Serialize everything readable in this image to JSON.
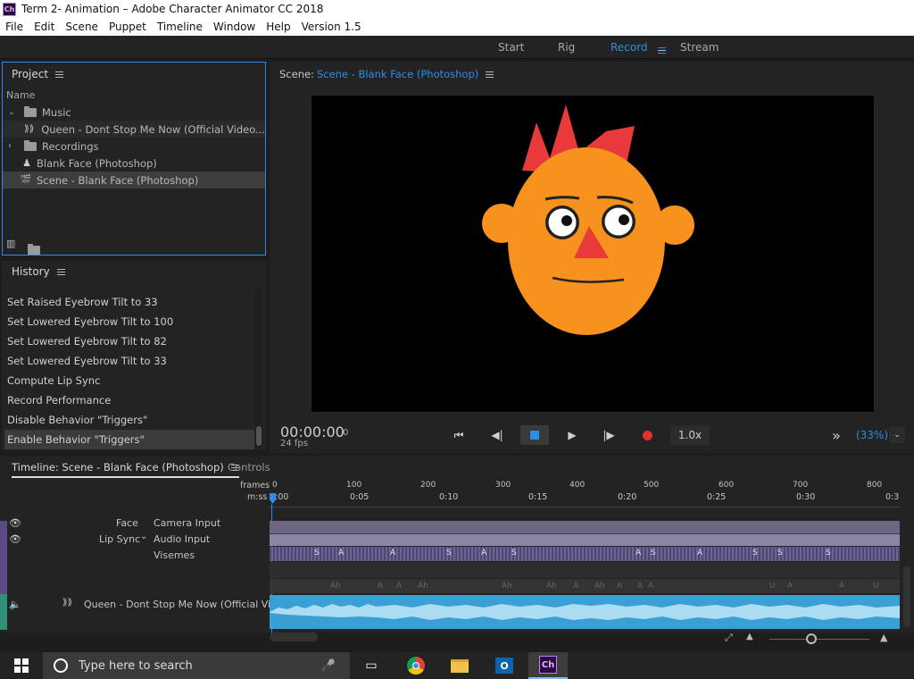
{
  "window": {
    "title": "Term 2- Animation – Adobe Character Animator CC 2018",
    "app_icon": "Ch"
  },
  "menu": [
    "File",
    "Edit",
    "Scene",
    "Puppet",
    "Timeline",
    "Window",
    "Help",
    "Version 1.5"
  ],
  "workspaces": {
    "start": "Start",
    "rig": "Rig",
    "record": "Record",
    "stream": "Stream"
  },
  "project": {
    "title": "Project",
    "column_header": "Name",
    "items": [
      {
        "label": "Music",
        "icon": "folder-icon"
      },
      {
        "label": "Queen - Dont Stop Me Now (Official Video...",
        "icon": "audio-icon"
      },
      {
        "label": "Recordings",
        "icon": "folder-icon"
      },
      {
        "label": "Blank Face (Photoshop)",
        "icon": "puppet-icon"
      },
      {
        "label": "Scene - Blank Face (Photoshop)",
        "icon": "scene-icon"
      }
    ]
  },
  "history": {
    "title": "History",
    "items": [
      "Set Raised Eyebrow Tilt to 33",
      "Set Lowered Eyebrow Tilt to 100",
      "Set Lowered Eyebrow Tilt to 82",
      "Set Lowered Eyebrow Tilt to 33",
      "Compute Lip Sync",
      "Record Performance",
      "Disable Behavior \"Triggers\"",
      "Enable Behavior \"Triggers\""
    ]
  },
  "scene": {
    "label_prefix": "Scene:",
    "name": "Scene - Blank Face (Photoshop)",
    "timecode": "00:00:00",
    "frame": "0",
    "fps": "24 fps",
    "speed": "1.0x",
    "zoom": "(33%)",
    "more": "»"
  },
  "timeline": {
    "title": "Timeline: Scene - Blank Face (Photoshop)",
    "tab_controls": "Controls",
    "frames_label": "frames",
    "mss_label": "m:ss",
    "frame_ticks": [
      "0",
      "100",
      "200",
      "300",
      "400",
      "500",
      "600",
      "700",
      "800"
    ],
    "time_ticks": [
      "0:00",
      "0:05",
      "0:10",
      "0:15",
      "0:20",
      "0:25",
      "0:30",
      "0:3"
    ],
    "tracks": {
      "face": "Face",
      "camera_input": "Camera Input",
      "lip_sync": "Lip Sync",
      "audio_input": "Audio Input",
      "visemes": "Visemes",
      "audio_track": "Queen - Dont Stop Me Now (Official Vi..."
    },
    "visemes_row1": [
      "S",
      "A",
      "A",
      "S",
      "A",
      "S",
      "A",
      "S",
      "A",
      "S",
      "S",
      "S"
    ],
    "visemes_row2": [
      "Ah",
      "A",
      "A",
      "Ah",
      "Ah",
      "Ah",
      "A",
      "Ah",
      "A",
      "A",
      "A",
      "U",
      "A",
      "A",
      "U"
    ]
  },
  "taskbar": {
    "search_placeholder": "Type here to search",
    "ch_label": "Ch"
  },
  "colors": {
    "accent": "#2d8ceb",
    "record": "#e03030",
    "face": "#f7921e",
    "crown": "#e83a3a",
    "audio": "#4bb5e8"
  }
}
